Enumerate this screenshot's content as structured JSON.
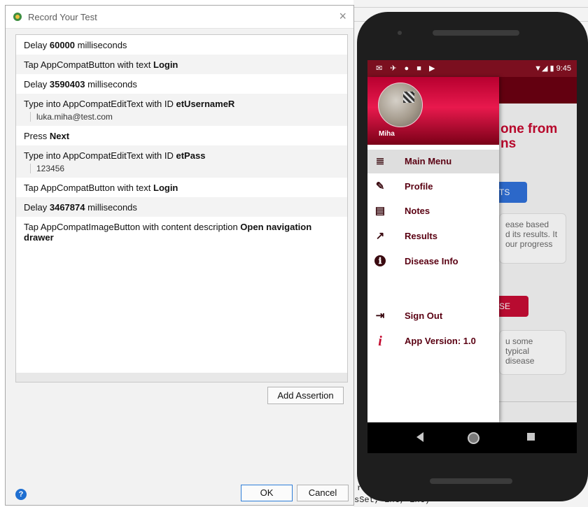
{
  "dialog": {
    "title": "Record Your Test",
    "close_glyph": "×",
    "steps": [
      {
        "text": "Delay ",
        "bold": "60000",
        "suffix": " milliseconds",
        "value": ""
      },
      {
        "text": "Tap AppCompatButton with text ",
        "bold": "Login",
        "suffix": "",
        "value": ""
      },
      {
        "text": "Delay ",
        "bold": "3590403",
        "suffix": " milliseconds",
        "value": ""
      },
      {
        "text": "Type into AppCompatEditText with ID ",
        "bold": "etUsernameR",
        "suffix": "",
        "value": "luka.miha@test.com"
      },
      {
        "text": "Press ",
        "bold": "Next",
        "suffix": "",
        "value": ""
      },
      {
        "text": "Type into AppCompatEditText with ID ",
        "bold": "etPass",
        "suffix": "",
        "value": "123456"
      },
      {
        "text": "Tap AppCompatButton with text ",
        "bold": "Login",
        "suffix": "",
        "value": ""
      },
      {
        "text": "Delay ",
        "bold": "3467874",
        "suffix": " milliseconds",
        "value": ""
      },
      {
        "text": "Tap AppCompatImageButton with content description ",
        "bold": "Open navigation drawer",
        "suffix": "",
        "value": ""
      }
    ],
    "add_assertion_label": "Add Assertion",
    "ok_label": "OK",
    "cancel_label": "Cancel",
    "help_glyph": "?",
    "help_icon": "help-circle-icon"
  },
  "phone": {
    "status": {
      "left_icons": "✉ ✈ ● ■ ▶",
      "right": "▼◢ ▮ 9:45"
    },
    "user_name": "Miha",
    "menu": [
      {
        "label": "Main Menu",
        "icon": "≣",
        "icon_name": "main-menu-icon",
        "selected": true
      },
      {
        "label": "Profile",
        "icon": "✎",
        "icon_name": "profile-icon",
        "selected": false
      },
      {
        "label": "Notes",
        "icon": "▤",
        "icon_name": "notes-icon",
        "selected": false
      },
      {
        "label": "Results",
        "icon": "↗",
        "icon_name": "results-icon",
        "selected": false
      },
      {
        "label": "Disease Info",
        "icon": "ℹ",
        "icon_name": "info-icon",
        "selected": false
      },
      {
        "label": "Sign Out",
        "icon": "⇥",
        "icon_name": "sign-out-icon",
        "selected": false
      },
      {
        "label": "App Version: 1.0",
        "icon": "i",
        "icon_name": "version-info-icon",
        "selected": false
      }
    ],
    "background": {
      "heading_line1": "one from",
      "heading_line2": "ns",
      "button1": "TS",
      "card1": [
        "ease based",
        "d its results. It",
        "our progress"
      ],
      "button2": "SE",
      "card2": [
        "u some",
        "typical",
        "disease"
      ]
    }
  },
  "ide": {
    "code_line1": "ribu",
    "code_line2": "sSet, int, int)"
  },
  "colors": {
    "brand_red": "#c3082e",
    "drawer_text": "#5a0012",
    "status_bar": "#7b0f1f",
    "help_blue": "#1f6fd1"
  }
}
